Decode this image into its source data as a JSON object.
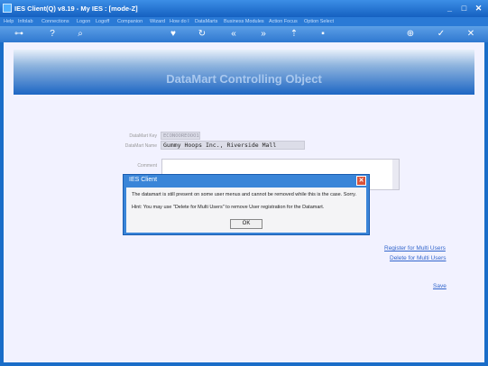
{
  "window": {
    "title": "IES Client(Q) v8.19 - My IES :      [mode-Z]",
    "controls": [
      "_",
      "□",
      "✕"
    ]
  },
  "menu": {
    "items": [
      "Help",
      "Infolab",
      "Connections",
      "Logon",
      "Logoff",
      "Companion",
      "Wizard",
      "How do I",
      "DataMarts",
      "Business Modules",
      "Action Focus",
      "Option Select"
    ]
  },
  "toolbar": {
    "icons": [
      "back-key-icon",
      "help-icon",
      "search-icon",
      "heart-icon",
      "refresh-icon",
      "rewind-icon",
      "fast-forward-icon",
      "upload-icon",
      "save-icon",
      "add-icon",
      "check-icon",
      "close-icon"
    ]
  },
  "page": {
    "title": "DataMart Controlling Object"
  },
  "form": {
    "datamart_key_label": "DataMart Key",
    "datamart_key_value": "ECONOOREOOO1",
    "datamart_name_label": "DataMart Name",
    "datamart_name_value": "Gummy Hoops Inc., Riverside Mall",
    "comment_label": "Comment",
    "comment_value": ""
  },
  "links": {
    "register_multi": "Register for Multi Users",
    "delete_multi": "Delete for Multi Users",
    "save": "Save"
  },
  "dialog": {
    "title": "IES Client",
    "message": "The datamart is still present on some user menus and cannot be removed while this is the case. Sorry.",
    "hint": "Hint: You may use \"Delete for Multi Users\" to remove User registration for the Datamart.",
    "ok_label": "OK",
    "close_label": "✕"
  }
}
